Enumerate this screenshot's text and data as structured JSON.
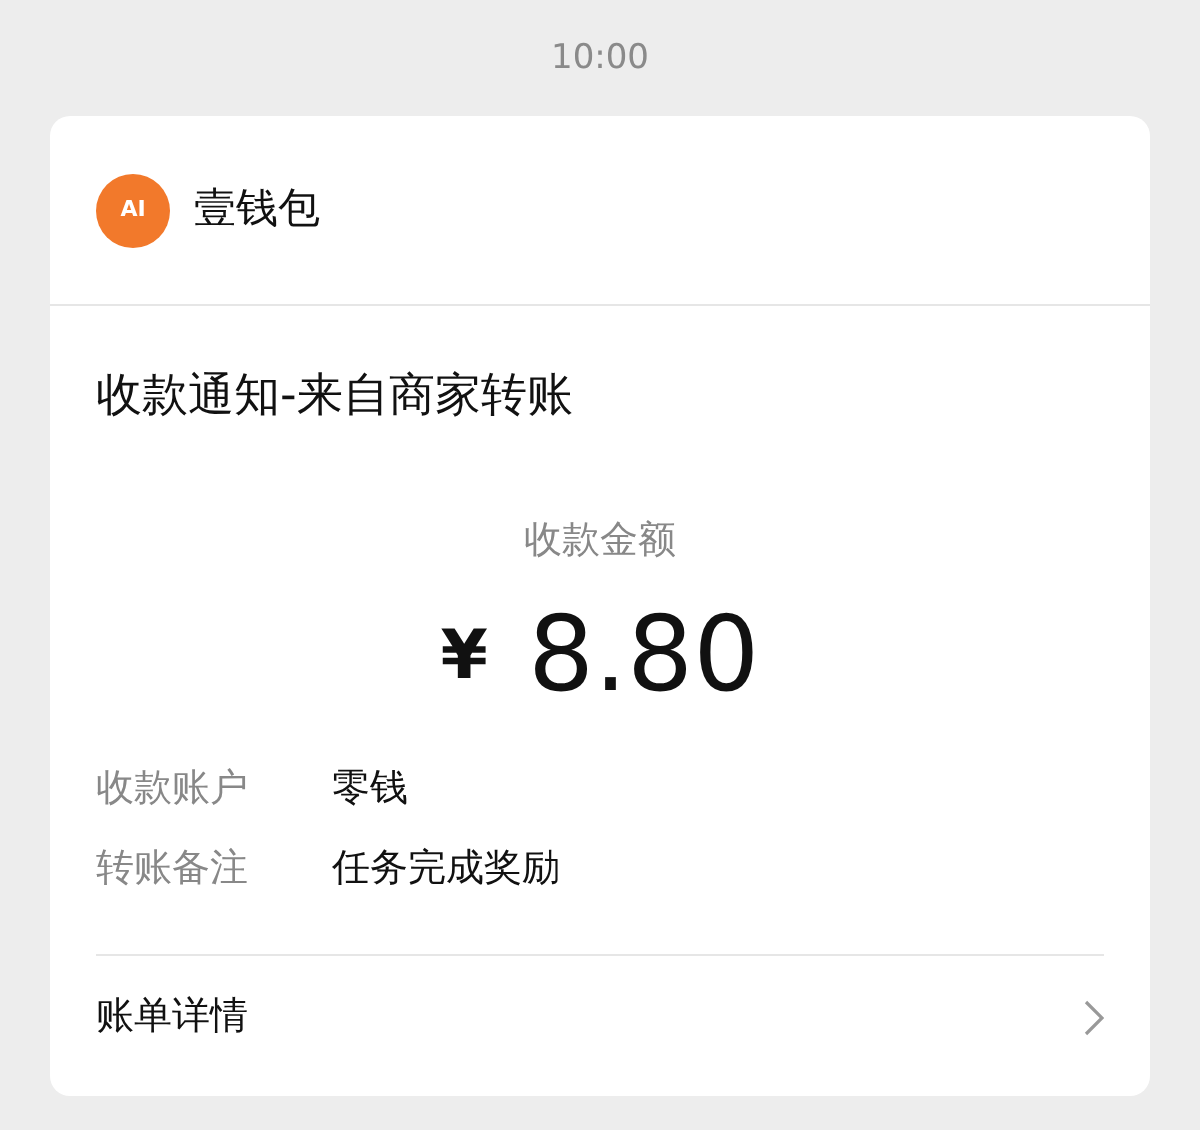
{
  "time": "10:00",
  "app": {
    "logo_text": "AI",
    "name": "壹钱包"
  },
  "title": "收款通知-来自商家转账",
  "amount": {
    "label": "收款金额",
    "currency": "¥",
    "value": "8.80"
  },
  "details": [
    {
      "label": "收款账户",
      "value": "零钱"
    },
    {
      "label": "转账备注",
      "value": "任务完成奖励"
    }
  ],
  "footer": {
    "label": "账单详情"
  }
}
